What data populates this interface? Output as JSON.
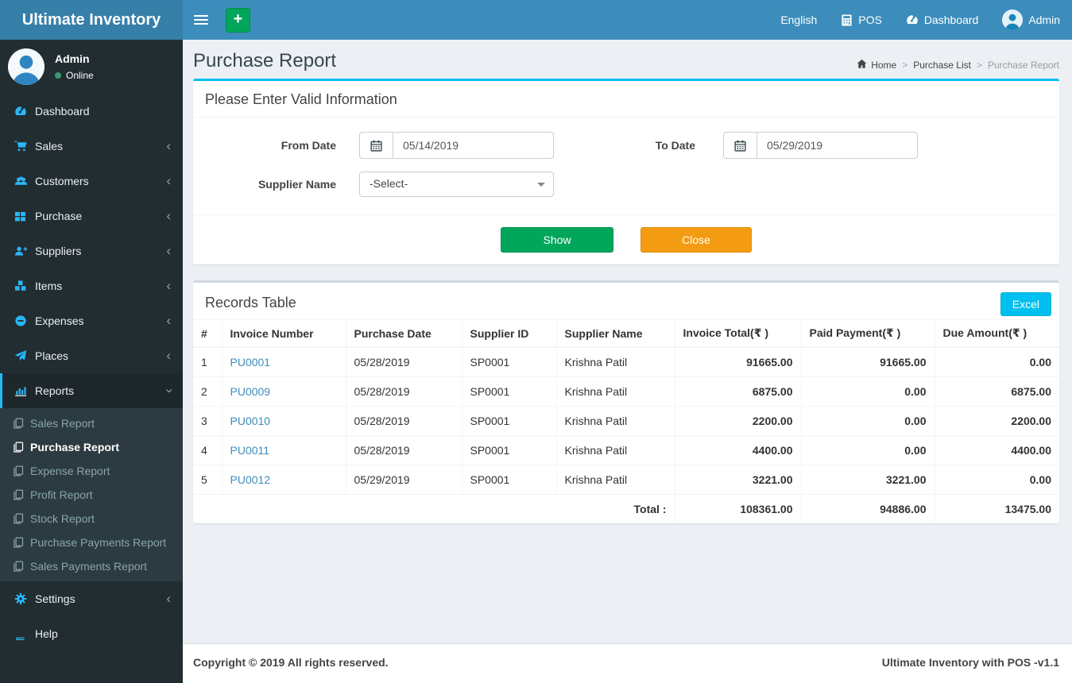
{
  "navbar": {
    "brand": "Ultimate Inventory",
    "language": "English",
    "pos": "POS",
    "dashboard": "Dashboard",
    "user": "Admin"
  },
  "sidebar": {
    "user": {
      "name": "Admin",
      "status": "Online"
    },
    "items": [
      {
        "label": "Dashboard"
      },
      {
        "label": "Sales"
      },
      {
        "label": "Customers"
      },
      {
        "label": "Purchase"
      },
      {
        "label": "Suppliers"
      },
      {
        "label": "Items"
      },
      {
        "label": "Expenses"
      },
      {
        "label": "Places"
      },
      {
        "label": "Reports"
      },
      {
        "label": "Settings"
      },
      {
        "label": "Help"
      }
    ],
    "reports_submenu": [
      {
        "label": "Sales Report"
      },
      {
        "label": "Purchase Report"
      },
      {
        "label": "Expense Report"
      },
      {
        "label": "Profit Report"
      },
      {
        "label": "Stock Report"
      },
      {
        "label": "Purchase Payments Report"
      },
      {
        "label": "Sales Payments Report"
      }
    ]
  },
  "page": {
    "title": "Purchase Report",
    "breadcrumb": {
      "home": "Home",
      "middle": "Purchase List",
      "current": "Purchase Report"
    }
  },
  "filter": {
    "title": "Please Enter Valid Information",
    "from_date": {
      "label": "From Date",
      "value": "05/14/2019"
    },
    "to_date": {
      "label": "To Date",
      "value": "05/29/2019"
    },
    "supplier": {
      "label": "Supplier Name",
      "value": "-Select-"
    },
    "show_button": "Show",
    "close_button": "Close"
  },
  "records": {
    "title": "Records Table",
    "excel_button": "Excel",
    "table": {
      "headers": [
        "#",
        "Invoice Number",
        "Purchase Date",
        "Supplier ID",
        "Supplier Name",
        "Invoice Total(₹ )",
        "Paid Payment(₹ )",
        "Due Amount(₹ )"
      ],
      "rows": [
        [
          "1",
          "PU0001",
          "05/28/2019",
          "SP0001",
          "Krishna Patil",
          "91665.00",
          "91665.00",
          "0.00"
        ],
        [
          "2",
          "PU0009",
          "05/28/2019",
          "SP0001",
          "Krishna Patil",
          "6875.00",
          "0.00",
          "6875.00"
        ],
        [
          "3",
          "PU0010",
          "05/28/2019",
          "SP0001",
          "Krishna Patil",
          "2200.00",
          "0.00",
          "2200.00"
        ],
        [
          "4",
          "PU0011",
          "05/28/2019",
          "SP0001",
          "Krishna Patil",
          "4400.00",
          "0.00",
          "4400.00"
        ],
        [
          "5",
          "PU0012",
          "05/29/2019",
          "SP0001",
          "Krishna Patil",
          "3221.00",
          "3221.00",
          "0.00"
        ]
      ],
      "total_label": "Total :",
      "totals": [
        "108361.00",
        "94886.00",
        "13475.00"
      ]
    }
  },
  "footer": {
    "left": "Copyright © 2019 All rights reserved.",
    "right": "Ultimate Inventory with POS -v1.1"
  },
  "colors": {
    "navbar": "#3c8dbc",
    "logo_bg": "#367fa9",
    "sidebar_bg": "#222d32",
    "submenu_bg": "#2c3b41",
    "active_item_bg": "#1e282c",
    "sidebar_icon": "#29b6f6",
    "success": "#00a65a",
    "warning": "#f39c12",
    "info": "#00c0ef",
    "link": "#3c8dbc",
    "online_dot": "#3d9970",
    "panel_top_info": "#00c0ef",
    "panel_top_default": "#d2d6de"
  }
}
